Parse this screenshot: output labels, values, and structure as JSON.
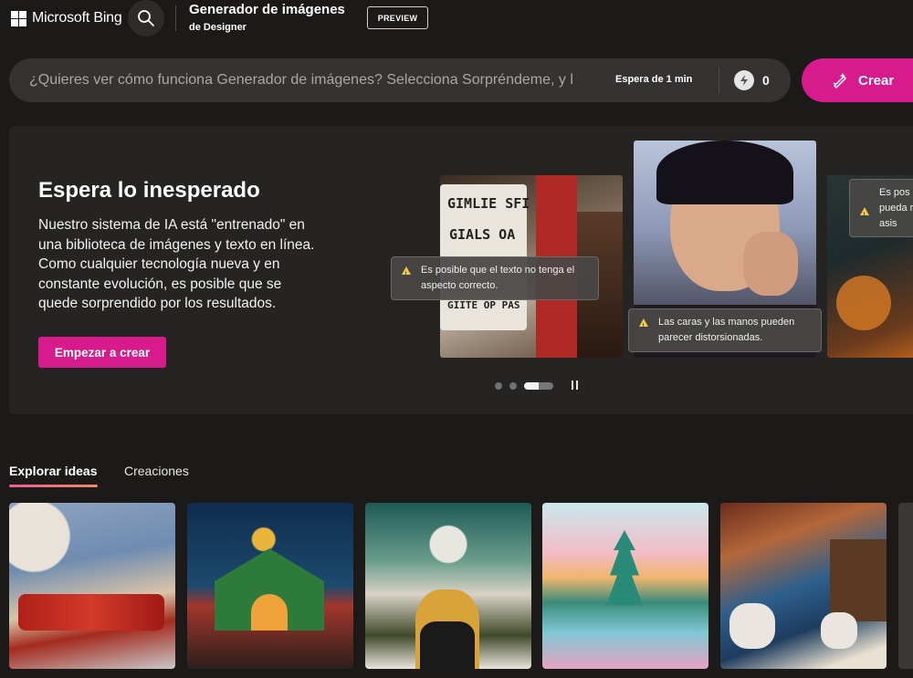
{
  "header": {
    "brand": "Microsoft Bing",
    "app_title": "Generador de imágenes",
    "app_subtitle": "de Designer",
    "badge": "PREVIEW"
  },
  "prompt": {
    "placeholder": "¿Quieres ver cómo funciona Generador de imágenes? Selecciona Sorpréndeme, y l",
    "wait": "Espera de 1 min",
    "boost_count": "0",
    "create_label": "Crear"
  },
  "hero": {
    "title": "Espera lo inesperado",
    "body": "Nuestro sistema de IA está \"entrenado\" en una biblioteca de imágenes y texto en línea. Como cualquier tecnología nueva y en constante evolución, es posible que se quede sorprendido por los resultados.",
    "cta": "Empezar a crear",
    "slide1_sign_lines": [
      "GIMLIE SFI",
      "GIALS OA",
      "GIITE OP PAS"
    ],
    "warnings": [
      "Es posible que el texto no tenga el aspecto correcto.",
      "Las caras y las manos pueden parecer distorsionadas.",
      "Es pos pueda r de asis"
    ],
    "carousel": {
      "count": 3,
      "active_index": 2
    }
  },
  "tabs": [
    {
      "label": "Explorar ideas",
      "active": true
    },
    {
      "label": "Creaciones",
      "active": false
    }
  ],
  "colors": {
    "accent": "#d81b8c",
    "background": "#1b1a19",
    "panel": "#252423",
    "input": "#343332",
    "warning": "#f2c94c"
  }
}
